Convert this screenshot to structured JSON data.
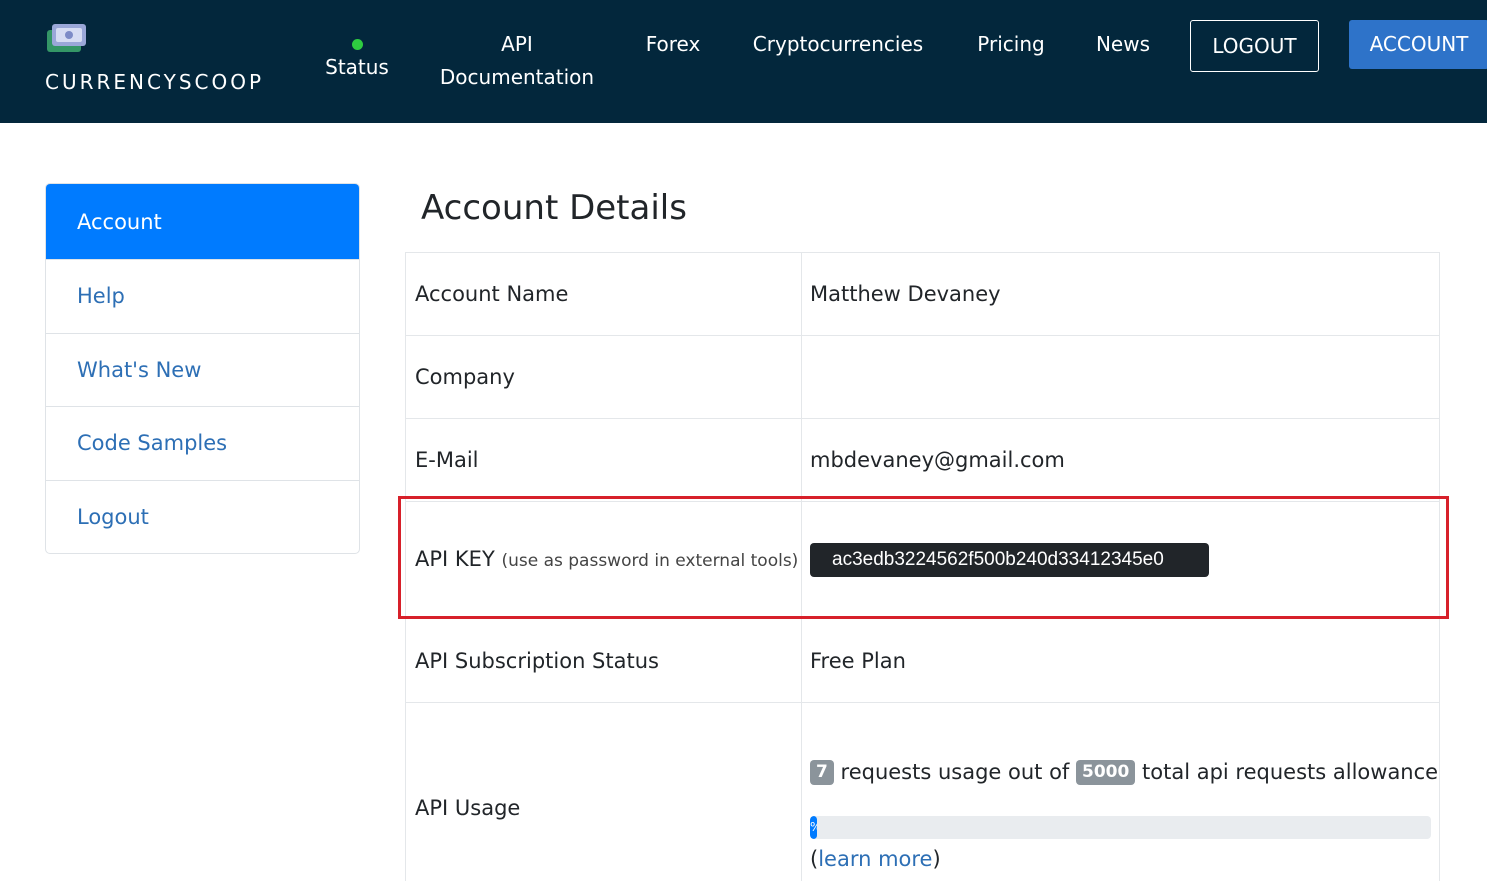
{
  "header": {
    "logo_text": "CURRENCYSCOOP",
    "logo_icon": "currency-notes-icon",
    "nav": {
      "status_label": "Status",
      "status_color": "#2ecc40",
      "api_docs_line1": "API",
      "api_docs_line2": "Documentation",
      "forex": "Forex",
      "crypto": "Cryptocurrencies",
      "pricing": "Pricing",
      "news": "News"
    },
    "logout_button": "LOGOUT",
    "account_button": "ACCOUNT",
    "background_color": "#03273c"
  },
  "sidebar": {
    "items": [
      {
        "label": "Account",
        "active": true
      },
      {
        "label": "Help",
        "active": false
      },
      {
        "label": "What's New",
        "active": false
      },
      {
        "label": "Code Samples",
        "active": false
      },
      {
        "label": "Logout",
        "active": false
      }
    ]
  },
  "main": {
    "title": "Account Details",
    "rows": {
      "account_name": {
        "label": "Account Name",
        "value": "Matthew Devaney"
      },
      "company": {
        "label": "Company",
        "value": ""
      },
      "email": {
        "label": "E-Mail",
        "value": "mbdevaney@gmail.com"
      },
      "api_key": {
        "label": "API KEY",
        "note": "(use as password in external tools)",
        "value": "ac3edb3224562f500b240d33412345e0"
      },
      "subscription": {
        "label": "API Subscription Status",
        "value": "Free Plan"
      },
      "usage": {
        "label": "API Usage",
        "used": "7",
        "text_mid": "requests usage out of",
        "total": "5000",
        "text_end": "total api requests allowance",
        "progress_fraction": 0.0014,
        "progress_text": "%",
        "learn_open": "(",
        "learn_more": "learn more",
        "learn_close": ")"
      }
    },
    "highlight_color": "#d7202a",
    "accent_color": "#007bff"
  }
}
